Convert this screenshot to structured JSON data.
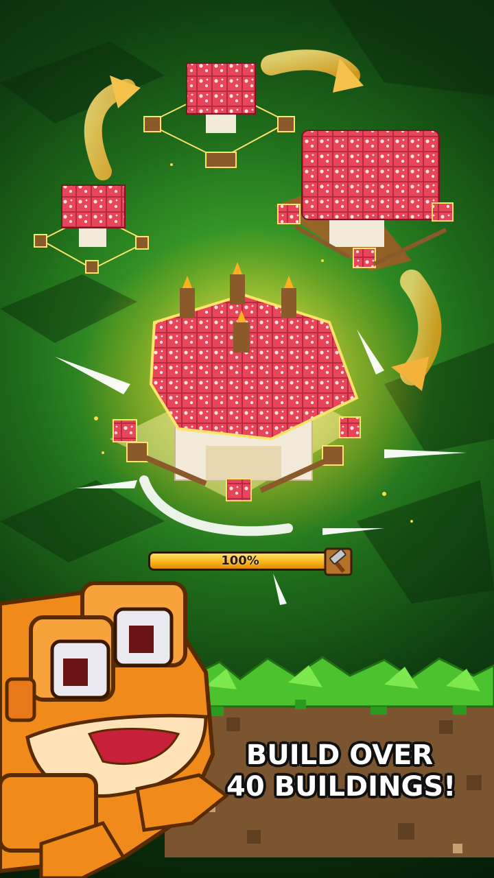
{
  "progress": {
    "label": "100%",
    "value": 1.0
  },
  "caption": {
    "line1": "BUILD OVER",
    "line2": "40 BUILDINGS!"
  },
  "icons": {
    "progress": "hammer-icon",
    "mascot": "orange-frog-mascot"
  },
  "colors": {
    "mushroom_red": "#e8455a",
    "grass_green": "#4cc22e",
    "progress_fill": "#f7b314",
    "dirt": "#7a5530"
  }
}
